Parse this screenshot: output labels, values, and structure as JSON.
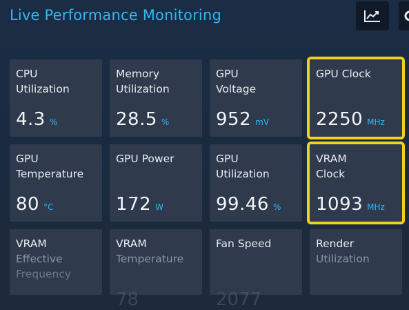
{
  "header": {
    "title": "Live Performance Monitoring",
    "buttons": [
      {
        "icon": "chart-icon"
      },
      {
        "icon": "settings-icon"
      }
    ]
  },
  "colors": {
    "accent": "#35b5f2",
    "highlight": "#f2d01e",
    "card": "#2f3a4c"
  },
  "metrics": [
    {
      "line1": "CPU",
      "line2": "Utilization",
      "value": "4.3",
      "unit": "%"
    },
    {
      "line1": "Memory",
      "line2": "Utilization",
      "value": "28.5",
      "unit": "%"
    },
    {
      "line1": "GPU",
      "line2": "Voltage",
      "value": "952",
      "unit": "mV"
    },
    {
      "line1": "GPU Clock",
      "line2": "",
      "value": "2250",
      "unit": "MHz",
      "highlighted": true
    },
    {
      "line1": "GPU",
      "line2": "Temperature",
      "value": "80",
      "unit": "°C"
    },
    {
      "line1": "GPU Power",
      "line2": "",
      "value": "172",
      "unit": "W"
    },
    {
      "line1": "GPU",
      "line2": "Utilization",
      "value": "99.46",
      "unit": "%"
    },
    {
      "line1": "VRAM",
      "line2": "Clock",
      "value": "1093",
      "unit": "MHz",
      "highlighted": true
    },
    {
      "line1": "VRAM",
      "line2": "Effective",
      "line3": "Frequency"
    },
    {
      "line1": "VRAM",
      "line2": "Temperature",
      "value": "78"
    },
    {
      "line1": "Fan Speed",
      "line2": "",
      "value": "2077"
    },
    {
      "line1": "Render",
      "line2": "Utilization"
    }
  ]
}
